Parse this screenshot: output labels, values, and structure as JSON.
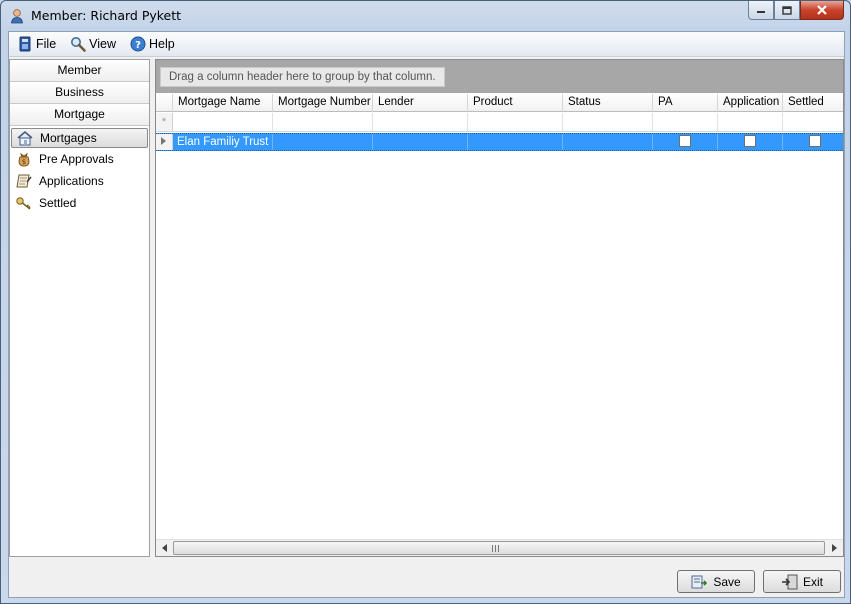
{
  "window": {
    "title": "Member: Richard Pykett"
  },
  "menu": {
    "file": "File",
    "view": "View",
    "help": "Help"
  },
  "sidebar": {
    "groups": [
      "Member",
      "Business",
      "Mortgage"
    ],
    "items": [
      {
        "label": "Mortgages",
        "icon": "house-icon",
        "selected": true
      },
      {
        "label": "Pre Approvals",
        "icon": "money-bag-icon",
        "selected": false
      },
      {
        "label": "Applications",
        "icon": "scroll-icon",
        "selected": false
      },
      {
        "label": "Settled",
        "icon": "key-icon",
        "selected": false
      }
    ]
  },
  "grid": {
    "group_hint": "Drag a column header here to group by that column.",
    "columns": [
      "Mortgage Name",
      "Mortgage Number",
      "Lender",
      "Product",
      "Status",
      "PA",
      "Application",
      "Settled"
    ],
    "new_row_marker": "*",
    "rows": [
      {
        "mortgage_name": "Elan Familiy Trust",
        "mortgage_number": "",
        "lender": "",
        "product": "",
        "status": "",
        "pa": false,
        "application": false,
        "settled": false
      }
    ]
  },
  "buttons": {
    "save": "Save",
    "exit": "Exit"
  },
  "colors": {
    "selection": "#3399ff",
    "group_area": "#a7a7a7"
  }
}
